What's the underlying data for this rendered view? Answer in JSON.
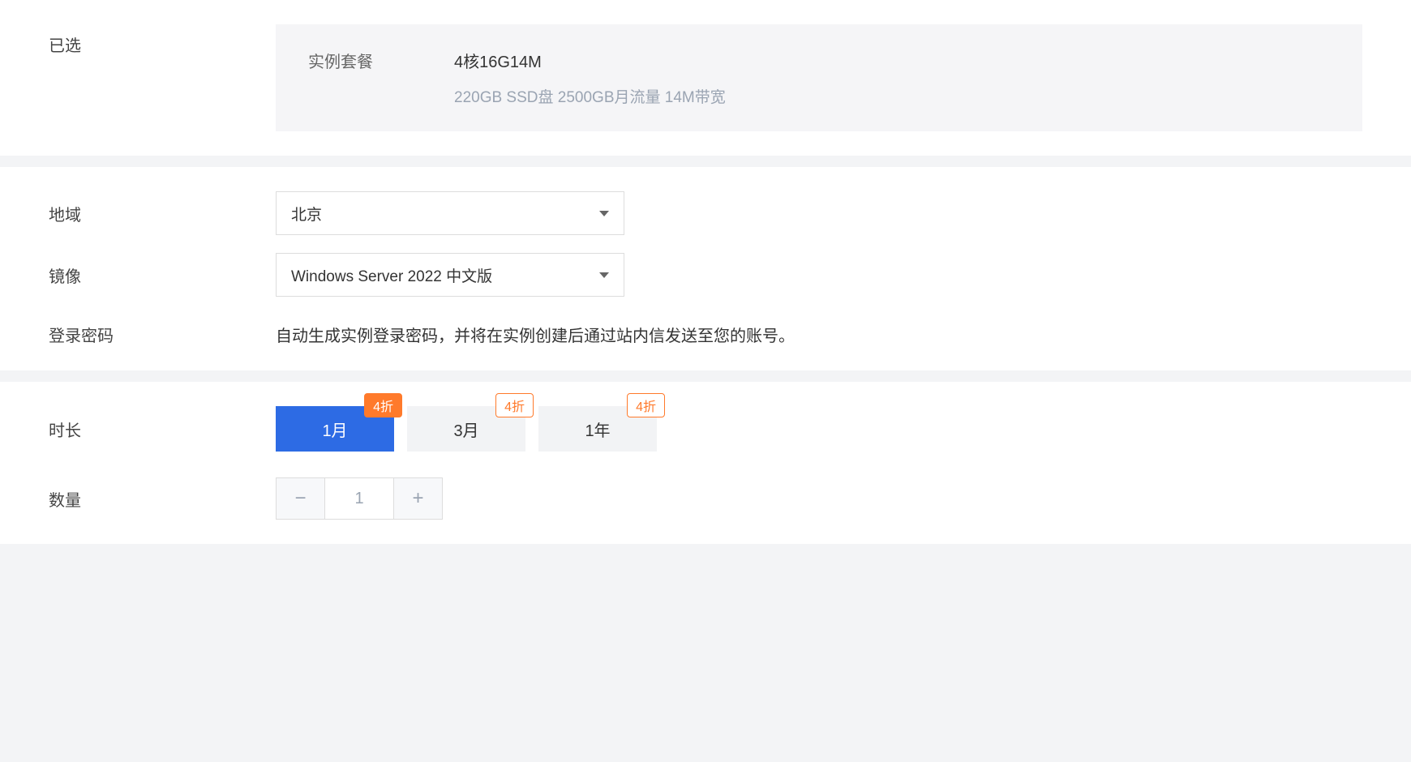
{
  "selected": {
    "label": "已选",
    "key": "实例套餐",
    "value": "4核16G14M",
    "sub": "220GB SSD盘 2500GB月流量 14M带宽"
  },
  "region": {
    "label": "地域",
    "value": "北京"
  },
  "image": {
    "label": "镜像",
    "value": "Windows Server 2022 中文版"
  },
  "password": {
    "label": "登录密码",
    "desc": "自动生成实例登录密码，并将在实例创建后通过站内信发送至您的账号。"
  },
  "duration": {
    "label": "时长",
    "options": [
      {
        "label": "1月",
        "discount": "4折",
        "active": true
      },
      {
        "label": "3月",
        "discount": "4折",
        "active": false
      },
      {
        "label": "1年",
        "discount": "4折",
        "active": false
      }
    ]
  },
  "quantity": {
    "label": "数量",
    "value": "1"
  }
}
